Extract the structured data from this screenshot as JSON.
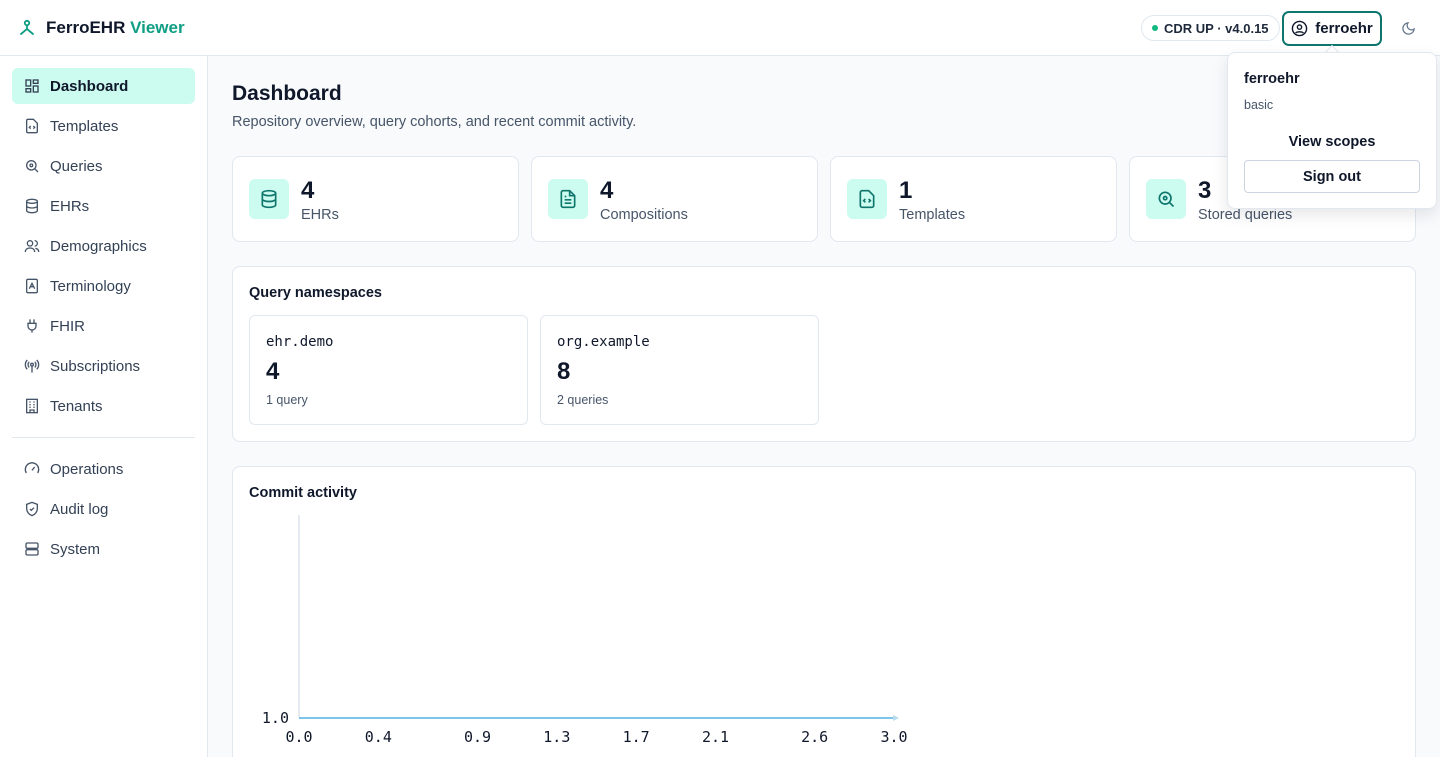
{
  "brand": {
    "name": "FerroEHR",
    "accent": "Viewer"
  },
  "status": {
    "text": "CDR UP · v4.0.15",
    "color": "#10b981"
  },
  "user": {
    "name": "ferroehr",
    "role": "basic",
    "view_scopes": "View scopes",
    "sign_out": "Sign out"
  },
  "sidebar": {
    "items": [
      {
        "label": "Dashboard",
        "icon": "dashboard-icon",
        "active": true
      },
      {
        "label": "Templates",
        "icon": "template-icon"
      },
      {
        "label": "Queries",
        "icon": "query-icon"
      },
      {
        "label": "EHRs",
        "icon": "database-icon"
      },
      {
        "label": "Demographics",
        "icon": "users-icon"
      },
      {
        "label": "Terminology",
        "icon": "book-icon"
      },
      {
        "label": "FHIR",
        "icon": "plug-icon"
      },
      {
        "label": "Subscriptions",
        "icon": "broadcast-icon"
      },
      {
        "label": "Tenants",
        "icon": "building-icon"
      }
    ],
    "secondary": [
      {
        "label": "Operations",
        "icon": "gauge-icon"
      },
      {
        "label": "Audit log",
        "icon": "shield-icon"
      },
      {
        "label": "System",
        "icon": "server-icon"
      }
    ]
  },
  "page": {
    "title": "Dashboard",
    "subtitle": "Repository overview, query cohorts, and recent commit activity."
  },
  "stats": [
    {
      "value": "4",
      "label": "EHRs",
      "icon": "database-icon"
    },
    {
      "value": "4",
      "label": "Compositions",
      "icon": "document-icon"
    },
    {
      "value": "1",
      "label": "Templates",
      "icon": "template-icon"
    },
    {
      "value": "3",
      "label": "Stored queries",
      "icon": "query-icon"
    }
  ],
  "namespaces": {
    "title": "Query namespaces",
    "items": [
      {
        "name": "ehr.demo",
        "count": "4",
        "sub": "1 query"
      },
      {
        "name": "org.example",
        "count": "8",
        "sub": "2 queries"
      }
    ]
  },
  "commit_activity": {
    "title": "Commit activity"
  },
  "chart_data": {
    "type": "line",
    "title": "Commit activity",
    "x_ticks": [
      "0.0",
      "0.4",
      "0.9",
      "1.3",
      "1.7",
      "2.1",
      "2.6",
      "3.0"
    ],
    "y_ticks": [
      "1.0"
    ],
    "series": [
      {
        "x": [
          0.0,
          3.0
        ],
        "y": [
          1.0,
          1.0
        ],
        "color": "#7cc4e8"
      }
    ],
    "xlim": [
      0.0,
      3.0
    ]
  },
  "colors": {
    "accent": "#0f9e84",
    "accent_bg": "#ccfbef",
    "border": "#e2e8f0"
  }
}
